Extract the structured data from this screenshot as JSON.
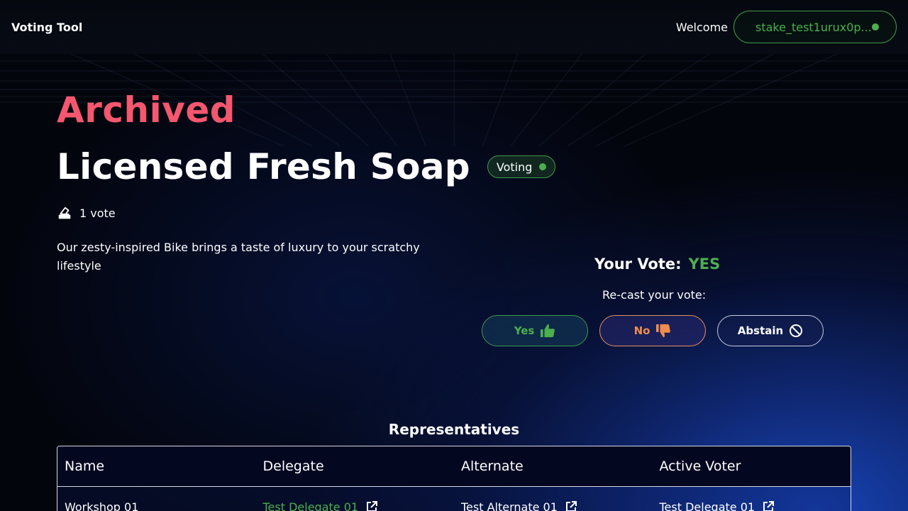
{
  "header": {
    "brand": "Voting Tool",
    "welcome": "Welcome",
    "stake_address": "stake_test1urux0p...",
    "status_color": "#4caf50"
  },
  "proposal": {
    "status": "Archived",
    "title": "Licensed Fresh Soap",
    "badge": "Voting",
    "votes": "1 vote",
    "description": "Our zesty-inspired Bike brings a taste of luxury to your scratchy lifestyle"
  },
  "vote": {
    "your_vote_label": "Your Vote:",
    "your_vote_value": "YES",
    "recast_label": "Re-cast your vote:",
    "buttons": {
      "yes": "Yes",
      "no": "No",
      "abstain": "Abstain"
    }
  },
  "representatives": {
    "title": "Representatives",
    "columns": [
      "Name",
      "Delegate",
      "Alternate",
      "Active Voter"
    ],
    "rows": [
      {
        "name": "Workshop 01",
        "delegate": "Test Delegate 01",
        "alternate": "Test Alternate 01",
        "active_voter": "Test Delegate 01"
      }
    ]
  },
  "colors": {
    "archived": "#f4576e",
    "accent_green": "#4caf50",
    "no_orange": "#ef8d4f"
  }
}
